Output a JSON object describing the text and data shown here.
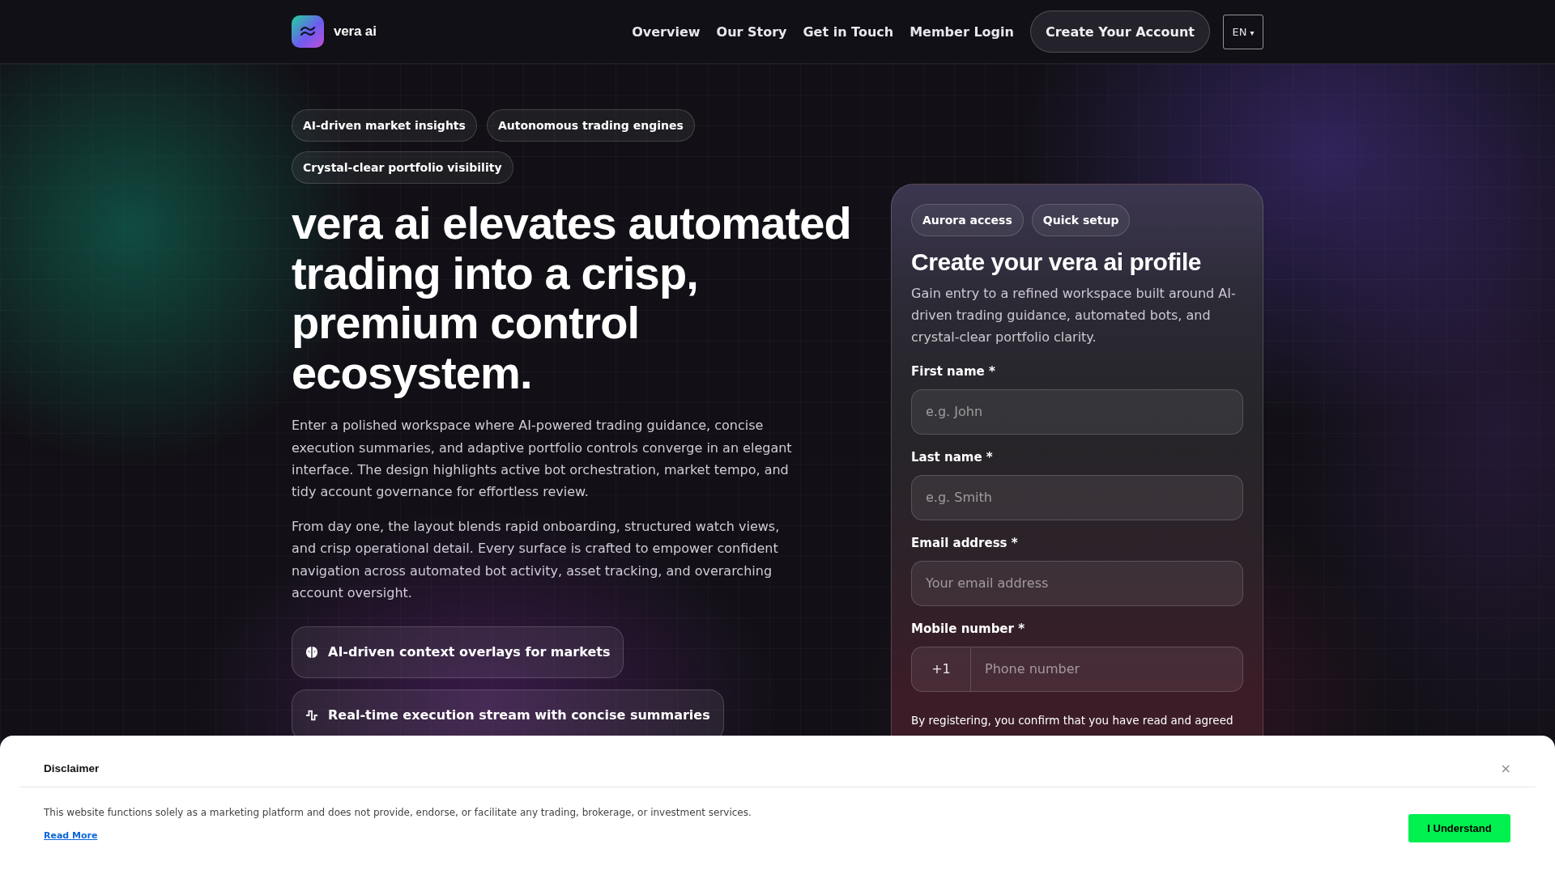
{
  "header": {
    "brand": "vera ai",
    "nav_links": [
      "Overview",
      "Our Story",
      "Get in Touch",
      "Member Login"
    ],
    "cta_button": "Create Your Account",
    "language": {
      "label": "EN",
      "caret": "▾"
    }
  },
  "hero": {
    "tags": [
      "AI-driven market insights",
      "Autonomous trading engines",
      "Crystal-clear portfolio visibility"
    ],
    "title": "vera ai elevates automated trading into a crisp, premium control ecosystem.",
    "paragraphs": [
      "Enter a polished workspace where AI-powered trading guidance, concise execution summaries, and adaptive portfolio controls converge in an elegant interface. The design highlights active bot orchestration, market tempo, and tidy account governance for effortless review.",
      "From day one, the layout blends rapid onboarding, structured watch views, and crisp operational detail. Every surface is crafted to empower confident navigation across automated bot activity, asset tracking, and overarching account oversight."
    ],
    "features": [
      "AI-driven context overlays for markets",
      "Real-time execution stream with concise summaries"
    ]
  },
  "signup_card": {
    "tags": [
      "Aurora access",
      "Quick setup"
    ],
    "title": "Create your vera ai profile",
    "description": "Gain entry to a refined workspace built around AI-driven trading guidance, automated bots, and crystal-clear portfolio clarity.",
    "fields": [
      {
        "kind": "text",
        "label": "First name *",
        "placeholder": "e.g. John"
      },
      {
        "kind": "text",
        "label": "Last name *",
        "placeholder": "e.g. Smith"
      },
      {
        "kind": "email",
        "label": "Email address *",
        "placeholder": "Your email address"
      },
      {
        "kind": "phone",
        "label": "Mobile number *",
        "prefix": "+1",
        "placeholder": "Phone number"
      }
    ],
    "consent_text": "By registering, you confirm that you have read and agreed"
  },
  "disclaimer": {
    "title": "Disclaimer",
    "close": "×",
    "text": "This website functions solely as a marketing platform and does not provide, endorse, or facilitate any trading, brokerage, or investment services.",
    "link": "Read More",
    "button": "I Understand"
  }
}
